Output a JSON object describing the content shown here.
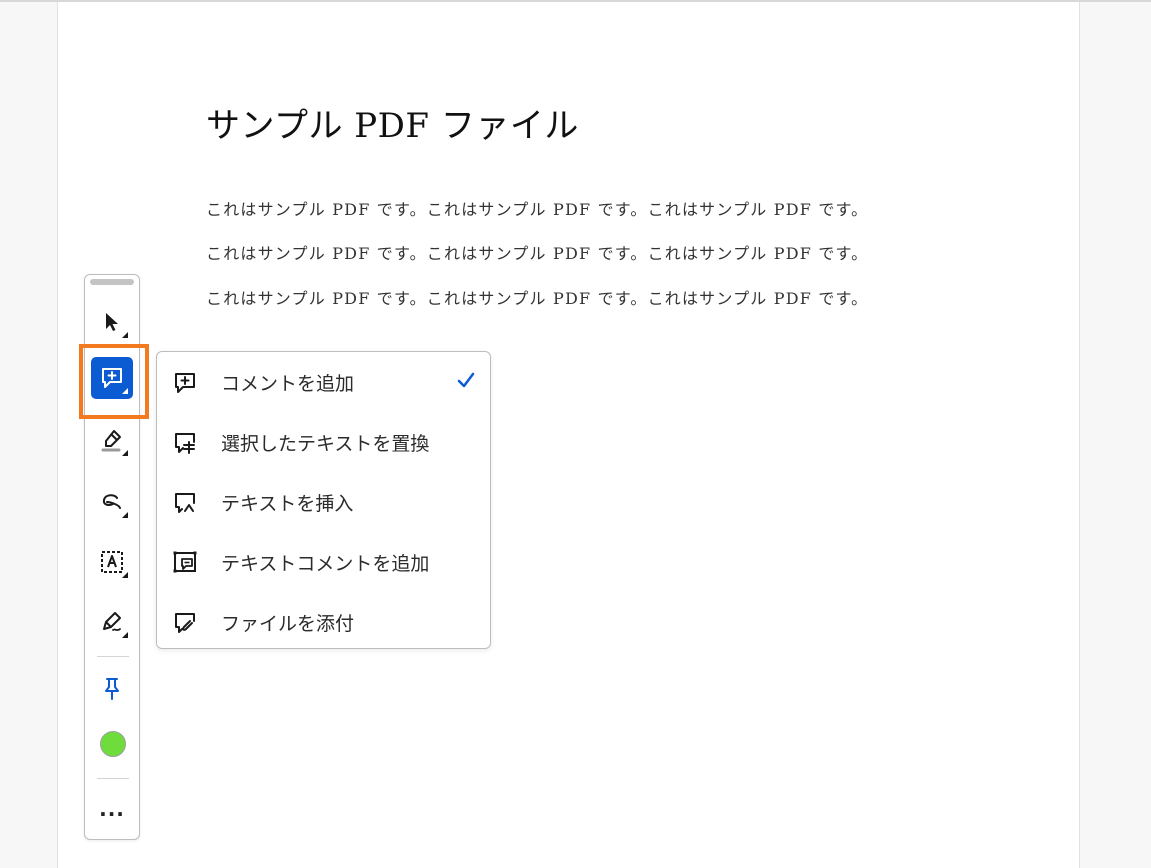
{
  "document": {
    "title": "サンプル PDF ファイル",
    "paragraphs": [
      "これはサンプル PDF です。これはサンプル PDF です。これはサンプル PDF です。",
      "これはサンプル PDF です。これはサンプル PDF です。これはサンプル PDF です。",
      "これはサンプル PDF です。これはサンプル PDF です。これはサンプル PDF です。"
    ]
  },
  "toolbar": {
    "tools": [
      {
        "name": "select-tool",
        "icon": "arrow-pointer-icon",
        "active": false
      },
      {
        "name": "add-comment-tool",
        "icon": "comment-plus-icon",
        "active": true
      },
      {
        "name": "highlight-tool",
        "icon": "highlighter-icon",
        "active": false
      },
      {
        "name": "draw-tool",
        "icon": "freehand-icon",
        "active": false
      },
      {
        "name": "text-box-tool",
        "icon": "text-box-icon",
        "active": false
      },
      {
        "name": "sign-tool",
        "icon": "pen-sign-icon",
        "active": false
      },
      {
        "name": "pin-tool",
        "icon": "pin-icon",
        "active": false
      }
    ],
    "current_color": "#6edc3a",
    "more_label": "..."
  },
  "menu": {
    "items": [
      {
        "label": "コメントを追加",
        "icon": "comment-plus-icon",
        "checked": true
      },
      {
        "label": "選択したテキストを置換",
        "icon": "replace-text-icon",
        "checked": false
      },
      {
        "label": "テキストを挿入",
        "icon": "insert-text-icon",
        "checked": false
      },
      {
        "label": "テキストコメントを追加",
        "icon": "text-comment-icon",
        "checked": false
      },
      {
        "label": "ファイルを添付",
        "icon": "attach-file-icon",
        "checked": false
      }
    ]
  },
  "colors": {
    "accent": "#0b5bd3",
    "highlight_outline": "#f47a20",
    "check": "#0b5bd3"
  }
}
